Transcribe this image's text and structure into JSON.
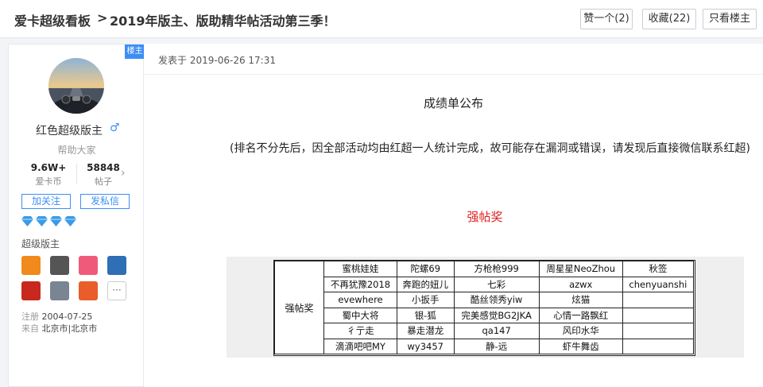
{
  "header": {
    "board": "爱卡超级看板",
    "separator": ">",
    "thread_title": "2019年版主、版助精华帖活动第三季！",
    "like_button": "赞一个(2)",
    "fav_button": "收藏(22)",
    "op_only_button": "只看楼主"
  },
  "author": {
    "op_badge": "楼主",
    "name": "红色超级版主",
    "title": "帮助大家",
    "coins_value": "9.6W+",
    "coins_label": "爱卡币",
    "posts_value": "58848",
    "posts_label": "帖子",
    "follow_button": "加关注",
    "message_button": "发私信",
    "level": "超级版主",
    "reg_label": "注册",
    "reg_date": "2004-07-25",
    "from_label": "来自",
    "from_city": "北京市|北京市",
    "more_medals": "···"
  },
  "post": {
    "time_label": "发表于",
    "time": "2019-06-26 17:31",
    "heading": "成绩单公布",
    "note": "(排名不分先后，因全部活动均由红超一人统计完成，故可能存在漏洞或错误，请发现后直接微信联系红超)",
    "award_heading": "强帖奖"
  },
  "award_table": {
    "category": "强帖奖",
    "rows": [
      [
        "蜜桃娃娃",
        "陀螺69",
        "方枪枪999",
        "周星星NeoZhou",
        "秋签"
      ],
      [
        "不再犹豫2018",
        "奔跑的妞儿",
        "七彩",
        "azwx",
        "chenyuanshi"
      ],
      [
        "evewhere",
        "小扳手",
        "酷丝领秀yiw",
        "炫猫",
        ""
      ],
      [
        "蜀中大将",
        "银-狐",
        "完美感觉BG2JKA",
        "心情一路飘红",
        ""
      ],
      [
        "彳亍走",
        "暴走潜龙",
        "qa147",
        "风印水华",
        ""
      ],
      [
        "滴滴吧吧MY",
        "wy3457",
        "静-远",
        "虾牛舞齿",
        ""
      ]
    ]
  },
  "colors": {
    "accent": "#3d8ef5",
    "award_red": "#e02020"
  }
}
